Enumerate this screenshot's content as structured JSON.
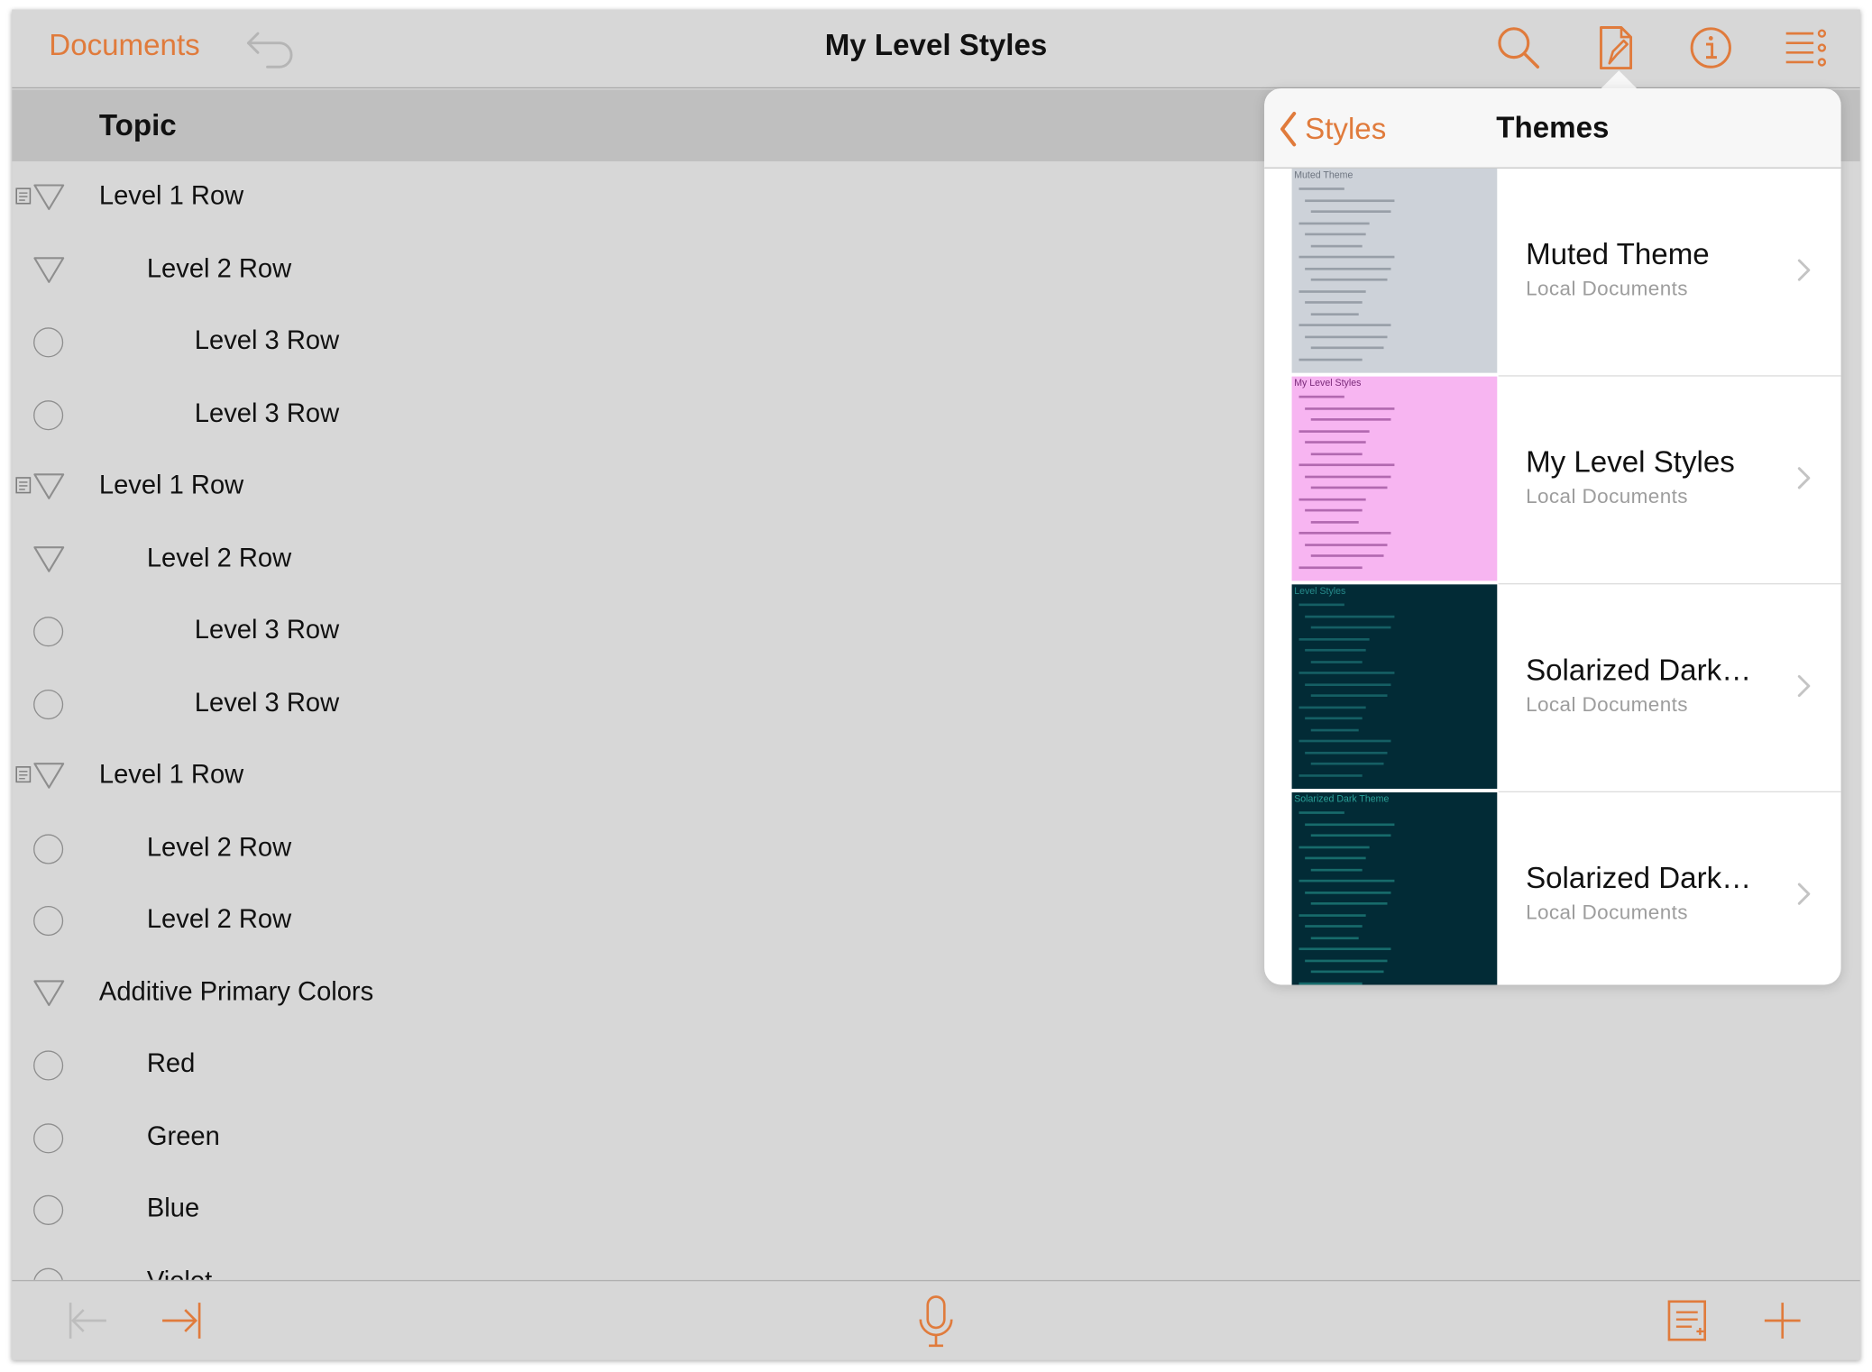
{
  "colors": {
    "accent": "#e07b3c",
    "background": "#d7d7d7",
    "header_band": "#bfbfbf"
  },
  "nav": {
    "back_label": "Documents",
    "title": "My Level Styles",
    "icons": [
      "undo-icon",
      "search-icon",
      "style-brush-icon",
      "info-icon",
      "outline-menu-icon"
    ]
  },
  "column": {
    "title": "Topic"
  },
  "rows": [
    {
      "label": "Level 1 Row",
      "level": 1,
      "handle": "triangle",
      "note": true
    },
    {
      "label": "Level 2 Row",
      "level": 2,
      "handle": "triangle",
      "note": false
    },
    {
      "label": "Level 3 Row",
      "level": 3,
      "handle": "circle",
      "note": false
    },
    {
      "label": "Level 3 Row",
      "level": 3,
      "handle": "circle",
      "note": false
    },
    {
      "label": "Level 1 Row",
      "level": 1,
      "handle": "triangle",
      "note": true
    },
    {
      "label": "Level 2 Row",
      "level": 2,
      "handle": "triangle",
      "note": false
    },
    {
      "label": "Level 3 Row",
      "level": 3,
      "handle": "circle",
      "note": false
    },
    {
      "label": "Level 3 Row",
      "level": 3,
      "handle": "circle",
      "note": false
    },
    {
      "label": "Level 1 Row",
      "level": 1,
      "handle": "triangle",
      "note": true
    },
    {
      "label": "Level 2 Row",
      "level": 2,
      "handle": "circle",
      "note": false
    },
    {
      "label": "Level 2 Row",
      "level": 2,
      "handle": "circle",
      "note": false
    },
    {
      "label": "Additive Primary Colors",
      "level": 1,
      "handle": "triangle",
      "note": false
    },
    {
      "label": "Red",
      "level": 2,
      "handle": "circle",
      "note": false
    },
    {
      "label": "Green",
      "level": 2,
      "handle": "circle",
      "note": false
    },
    {
      "label": "Blue",
      "level": 2,
      "handle": "circle",
      "note": false
    },
    {
      "label": "Violet",
      "level": 2,
      "handle": "circle",
      "note": false
    }
  ],
  "popover": {
    "back_label": "Styles",
    "title": "Themes",
    "themes": [
      {
        "name": "Muted Theme",
        "location": "Local Documents",
        "thumb_title": "Muted Theme",
        "thumb_bg": "#cdd2d9",
        "thumb_fg": "#6e7580"
      },
      {
        "name": "My Level Styles",
        "location": "Local Documents",
        "thumb_title": "My Level Styles",
        "thumb_bg": "#f7b5f1",
        "thumb_fg": "#7a2a7a"
      },
      {
        "name": "Solarized Dark…",
        "location": "Local Documents",
        "thumb_title": "Level Styles",
        "thumb_bg": "#022b36",
        "thumb_fg": "#268b8b"
      },
      {
        "name": "Solarized Dark…",
        "location": "Local Documents",
        "thumb_title": "Solarized Dark Theme",
        "thumb_bg": "#022b36",
        "thumb_fg": "#2aa198"
      }
    ]
  },
  "toolbar": {
    "icons": [
      "outdent-icon",
      "indent-icon",
      "microphone-icon",
      "note-icon",
      "add-icon"
    ]
  }
}
